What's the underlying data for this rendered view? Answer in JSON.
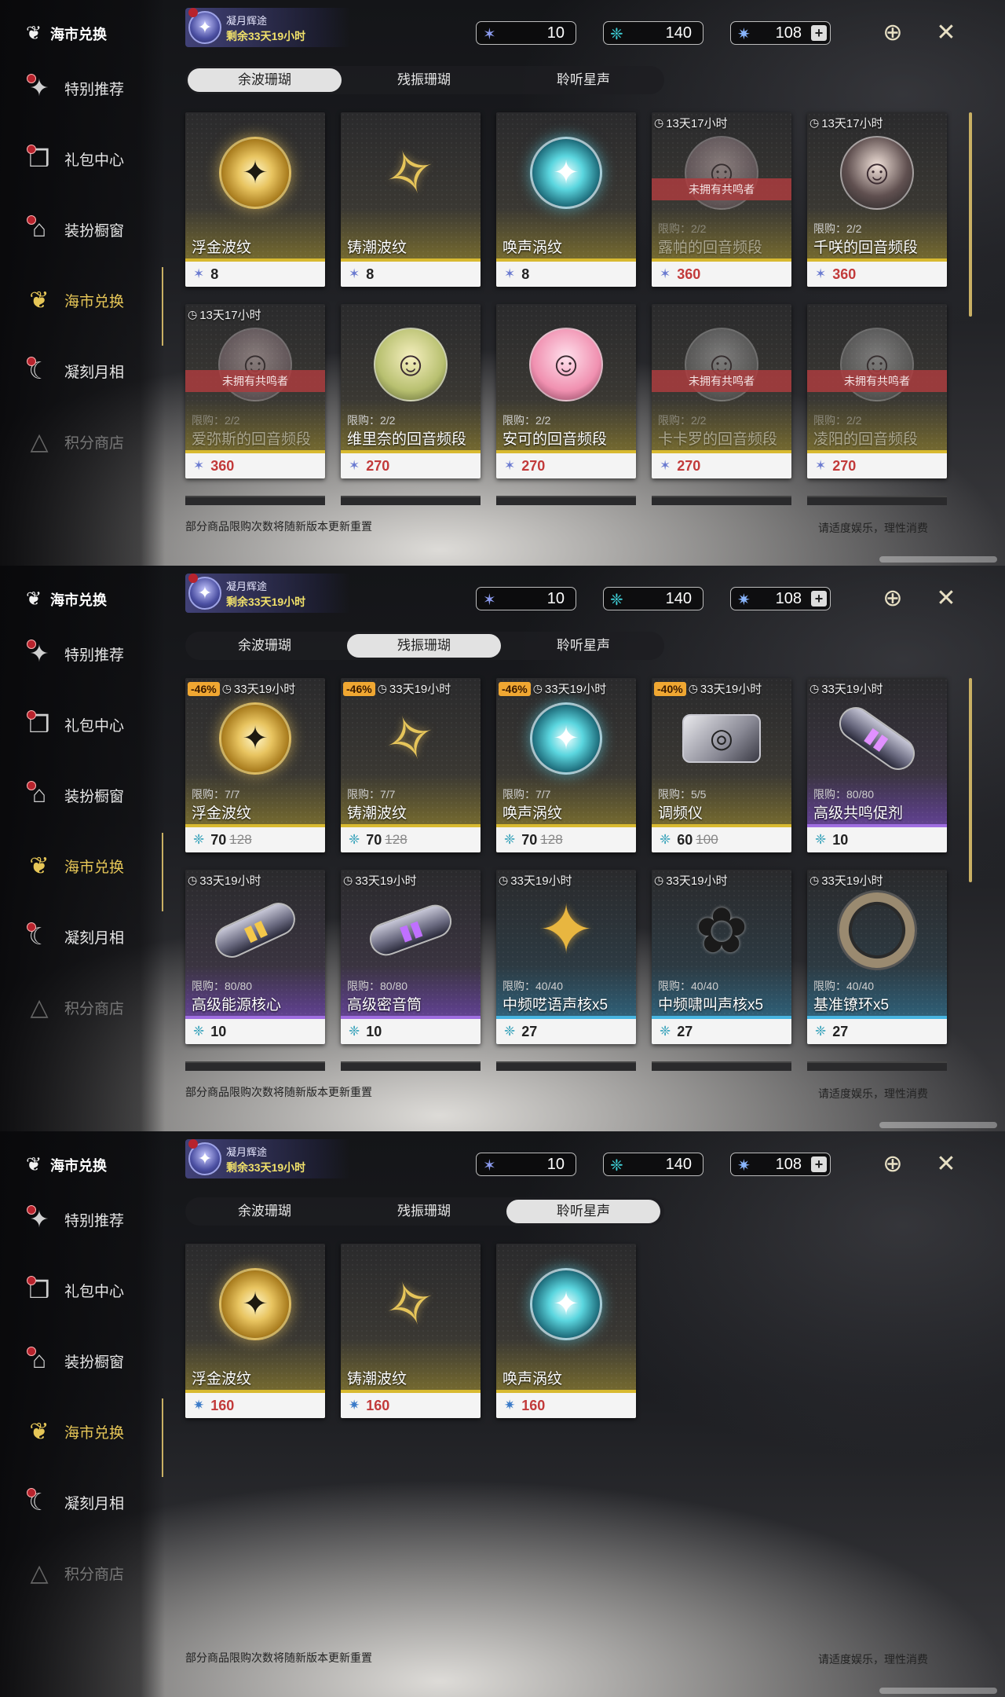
{
  "nav": {
    "title": "海市兑换",
    "items": [
      {
        "label": "特别推荐",
        "icon": "featured-icon",
        "dot": true,
        "state": "normal"
      },
      {
        "label": "礼包中心",
        "icon": "gift-icon",
        "dot": true,
        "state": "normal"
      },
      {
        "label": "装扮橱窗",
        "icon": "wardrobe-icon",
        "dot": true,
        "state": "normal"
      },
      {
        "label": "海市兑换",
        "icon": "coral-icon",
        "dot": false,
        "state": "active"
      },
      {
        "label": "凝刻月相",
        "icon": "moon-icon",
        "dot": true,
        "state": "normal"
      },
      {
        "label": "积分商店",
        "icon": "points-icon",
        "dot": false,
        "state": "dim"
      }
    ]
  },
  "event": {
    "title": "凝月辉途",
    "remaining": "剩余33天19小时"
  },
  "currencies": [
    {
      "icon": "purple-coral-icon",
      "value": "10"
    },
    {
      "icon": "teal-coral-icon",
      "value": "140"
    },
    {
      "icon": "star-coral-icon",
      "value": "108",
      "plus": "+"
    }
  ],
  "tabs": [
    "余波珊瑚",
    "残振珊瑚",
    "聆听星声"
  ],
  "footer": {
    "left": "部分商品限购次数将随新版本更新重置",
    "right": "请适度娱乐，理性消费"
  },
  "accent_color": "#d8b930",
  "panels": [
    {
      "active_tab": 0,
      "cards": [
        {
          "art": "gold-orb",
          "name": "浮金波纹",
          "price": "8",
          "currency": "purple"
        },
        {
          "art": "dagger",
          "name": "铸潮波纹",
          "price": "8",
          "currency": "purple"
        },
        {
          "art": "teal-orb",
          "name": "唤声涡纹",
          "price": "8",
          "currency": "purple"
        },
        {
          "timer": "13天17小时",
          "art": "portrait-pink",
          "owned_note": "未拥有共鸣者",
          "limit": "限购：2/2",
          "name": "露帕的回音频段",
          "price": "360",
          "currency": "purple",
          "red": true,
          "dim": true
        },
        {
          "timer": "13天17小时",
          "art": "portrait-dark",
          "limit": "限购：2/2",
          "name": "千咲的回音频段",
          "price": "360",
          "currency": "purple",
          "red": true
        },
        {
          "timer": "13天17小时",
          "art": "portrait-pink",
          "owned_note": "未拥有共鸣者",
          "limit": "限购：2/2",
          "name": "爱弥斯的回音频段",
          "price": "360",
          "currency": "purple",
          "red": true,
          "dim": true
        },
        {
          "art": "portrait-green",
          "limit": "限购：2/2",
          "name": "维里奈的回音频段",
          "price": "270",
          "currency": "purple",
          "red": true
        },
        {
          "art": "portrait-pinkhair",
          "limit": "限购：2/2",
          "name": "安可的回音频段",
          "price": "270",
          "currency": "purple",
          "red": true
        },
        {
          "art": "portrait-gray",
          "owned_note": "未拥有共鸣者",
          "limit": "限购：2/2",
          "name": "卡卡罗的回音频段",
          "price": "270",
          "currency": "purple",
          "red": true,
          "dim": true
        },
        {
          "art": "portrait-gray",
          "owned_note": "未拥有共鸣者",
          "limit": "限购：2/2",
          "name": "凌阳的回音频段",
          "price": "270",
          "currency": "purple",
          "red": true,
          "dim": true
        }
      ]
    },
    {
      "active_tab": 1,
      "cards": [
        {
          "discount": "-46%",
          "timer": "33天19小时",
          "art": "gold-orb",
          "limit": "限购：7/7",
          "name": "浮金波纹",
          "price": "70",
          "old_price": "128",
          "currency": "teal"
        },
        {
          "discount": "-46%",
          "timer": "33天19小时",
          "art": "dagger",
          "limit": "限购：7/7",
          "name": "铸潮波纹",
          "price": "70",
          "old_price": "128",
          "currency": "teal"
        },
        {
          "discount": "-46%",
          "timer": "33天19小时",
          "art": "teal-orb",
          "limit": "限购：7/7",
          "name": "唤声涡纹",
          "price": "70",
          "old_price": "128",
          "currency": "teal"
        },
        {
          "discount": "-40%",
          "timer": "33天19小时",
          "art": "device",
          "limit": "限购：5/5",
          "name": "调频仪",
          "price": "60",
          "old_price": "100",
          "currency": "teal"
        },
        {
          "timer": "33天19小时",
          "art": "tube-v",
          "limit": "限购：80/80",
          "name": "高级共鸣促剂",
          "price": "10",
          "currency": "teal",
          "color": "purple"
        },
        {
          "timer": "33天19小时",
          "art": "tube",
          "limit": "限购：80/80",
          "name": "高级能源核心",
          "price": "10",
          "currency": "teal",
          "color": "purple"
        },
        {
          "timer": "33天19小时",
          "art": "tube-mid",
          "limit": "限购：80/80",
          "name": "高级密音筒",
          "price": "10",
          "currency": "teal",
          "color": "purple"
        },
        {
          "timer": "33天19小时",
          "art": "star4",
          "limit": "限购：40/40",
          "name": "中频呓语声核x5",
          "price": "27",
          "currency": "teal",
          "color": "blue"
        },
        {
          "timer": "33天19小时",
          "art": "flower",
          "limit": "限购：40/40",
          "name": "中频啸叫声核x5",
          "price": "27",
          "currency": "teal",
          "color": "blue"
        },
        {
          "timer": "33天19小时",
          "art": "ring",
          "limit": "限购：40/40",
          "name": "基准镣环x5",
          "price": "27",
          "currency": "teal",
          "color": "blue"
        }
      ]
    },
    {
      "active_tab": 2,
      "cards": [
        {
          "art": "gold-orb",
          "name": "浮金波纹",
          "price": "160",
          "currency": "star",
          "red": true
        },
        {
          "art": "dagger",
          "name": "铸潮波纹",
          "price": "160",
          "currency": "star",
          "red": true
        },
        {
          "art": "teal-orb",
          "name": "唤声涡纹",
          "price": "160",
          "currency": "star",
          "red": true
        }
      ]
    }
  ]
}
